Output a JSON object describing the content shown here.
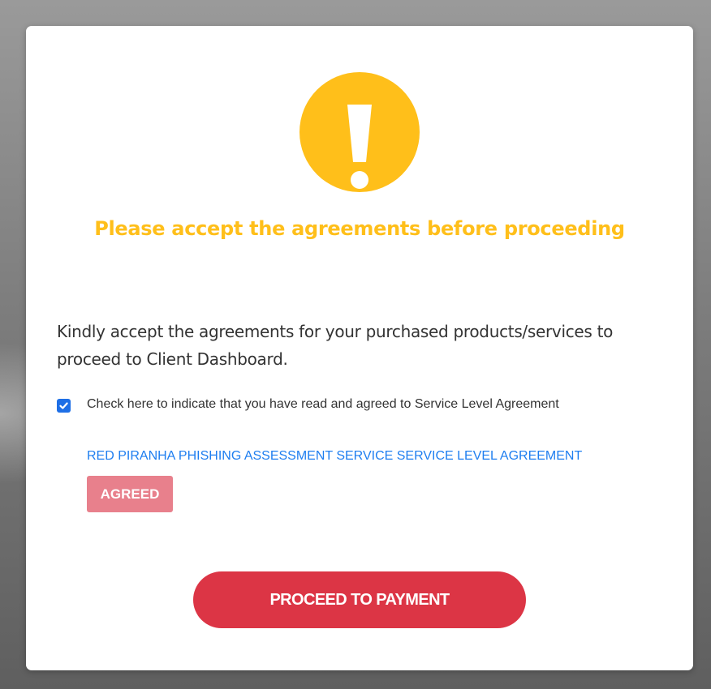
{
  "modal": {
    "title": "Please accept the agreements before proceeding",
    "icon": "exclamation-icon",
    "message": "Kindly accept the agreements for your purchased products/services to proceed to Client Dashboard.",
    "checkbox": {
      "checked": true,
      "label": "Check here to indicate that you have read and agreed to Service Level Agreement"
    },
    "agreement_link": "RED PIRANHA PHISHING ASSESSMENT SERVICE SERVICE LEVEL AGREEMENT",
    "agreed_button": "AGREED",
    "proceed_button": "PROCEED TO PAYMENT"
  },
  "colors": {
    "warning": "#ffbf1a",
    "link": "#1e7ef0",
    "checkbox": "#1e6fe6",
    "agreed_button": "#e8808c",
    "primary_button": "#dc3545"
  }
}
